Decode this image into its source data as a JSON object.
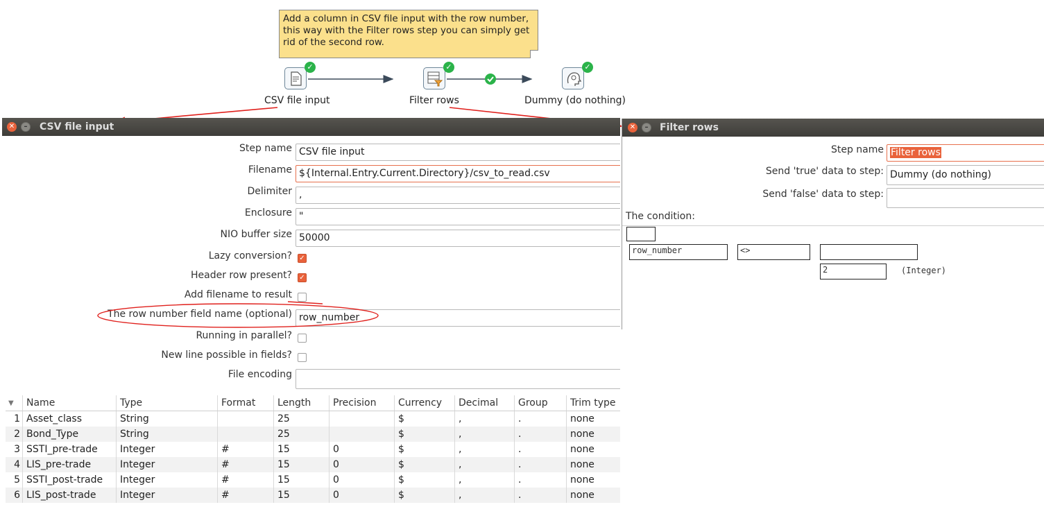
{
  "note": {
    "line1": "Add a column in CSV file input with the row number,",
    "line2": "this way with the Filter rows step you can simply get",
    "line3": "rid of the second row."
  },
  "steps": [
    {
      "label": "CSV file input",
      "icon": "csv-file-icon"
    },
    {
      "label": "Filter rows",
      "icon": "filter-rows-icon"
    },
    {
      "label": "Dummy (do nothing)",
      "icon": "dummy-icon"
    }
  ],
  "csv_dialog": {
    "title": "CSV file input",
    "fields": {
      "step_name": {
        "label": "Step name",
        "value": "CSV file input"
      },
      "filename": {
        "label": "Filename",
        "value": "${Internal.Entry.Current.Directory}/csv_to_read.csv"
      },
      "delimiter": {
        "label": "Delimiter",
        "value": ","
      },
      "enclosure": {
        "label": "Enclosure",
        "value": "\""
      },
      "nio_buffer": {
        "label": "NIO buffer size",
        "value": "50000"
      },
      "lazy_conversion": {
        "label": "Lazy conversion?",
        "checked": true
      },
      "header_row": {
        "label": "Header row present?",
        "checked": true
      },
      "add_filename": {
        "label": "Add filename to result",
        "checked": false
      },
      "row_number_field": {
        "label": "The row number field name (optional)",
        "value": "row_number"
      },
      "parallel": {
        "label": "Running in parallel?",
        "checked": false
      },
      "new_line": {
        "label": "New line possible in fields?",
        "checked": false
      },
      "encoding": {
        "label": "File encoding",
        "value": ""
      }
    },
    "table": {
      "headers": [
        "Name",
        "Type",
        "Format",
        "Length",
        "Precision",
        "Currency",
        "Decimal",
        "Group",
        "Trim type"
      ],
      "rows": [
        [
          "1",
          "Asset_class",
          "String",
          "",
          "25",
          "",
          "$",
          ",",
          ".",
          "none"
        ],
        [
          "2",
          "Bond_Type",
          "String",
          "",
          "25",
          "",
          "$",
          ",",
          ".",
          "none"
        ],
        [
          "3",
          "SSTI_pre-trade",
          "Integer",
          "#",
          "15",
          "0",
          "$",
          ",",
          ".",
          "none"
        ],
        [
          "4",
          "LIS_pre-trade",
          "Integer",
          "#",
          "15",
          "0",
          "$",
          ",",
          ".",
          "none"
        ],
        [
          "5",
          "SSTI_post-trade",
          "Integer",
          "#",
          "15",
          "0",
          "$",
          ",",
          ".",
          "none"
        ],
        [
          "6",
          "LIS_post-trade",
          "Integer",
          "#",
          "15",
          "0",
          "$",
          ",",
          ".",
          "none"
        ]
      ]
    }
  },
  "filter_dialog": {
    "title": "Filter rows",
    "step_name": {
      "label": "Step name",
      "value": "Filter rows"
    },
    "send_true": {
      "label": "Send 'true' data to step:",
      "value": "Dummy (do nothing)"
    },
    "send_false": {
      "label": "Send 'false' data to step:",
      "value": ""
    },
    "condition_label": "The condition:",
    "condition": {
      "field": "row_number",
      "operator": "<>",
      "value_field": "",
      "value": "2",
      "value_type": "(Integer)"
    }
  },
  "colors": {
    "hop": "#3b4a5a",
    "annotation": "#e0201c",
    "ok_badge": "#2bb34a",
    "note_bg": "#fbe08c",
    "accent": "#e9623b"
  }
}
